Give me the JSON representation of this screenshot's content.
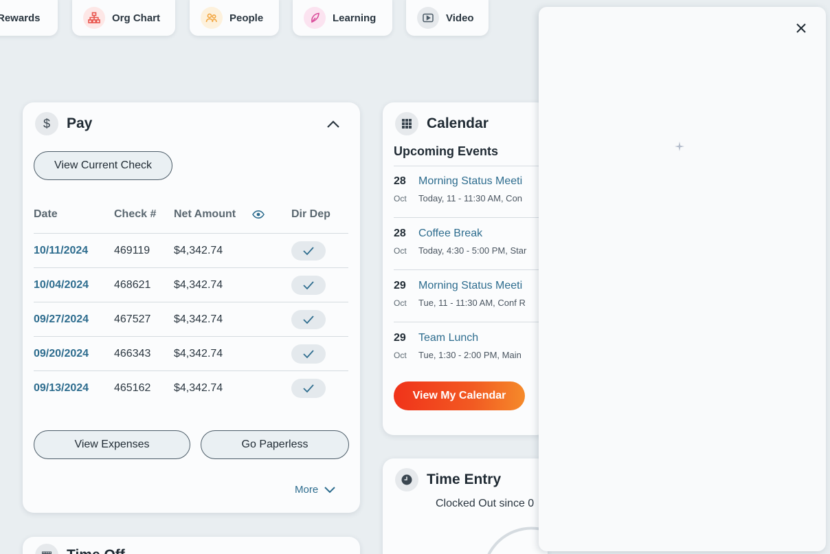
{
  "quick_links": [
    {
      "label": "Rewards",
      "icon": "rewards-icon"
    },
    {
      "label": "Org Chart",
      "icon": "org-chart-icon",
      "color": "#e8524a"
    },
    {
      "label": "People",
      "icon": "people-icon",
      "color": "#f2a640"
    },
    {
      "label": "Learning",
      "icon": "learning-icon",
      "color": "#d94c9a"
    },
    {
      "label": "Video",
      "icon": "video-icon",
      "color": "#4a5a66"
    }
  ],
  "pay": {
    "title": "Pay",
    "view_current_check": "View Current Check",
    "columns": {
      "date": "Date",
      "check": "Check #",
      "net_amount": "Net Amount",
      "dir_dep": "Dir Dep"
    },
    "rows": [
      {
        "date": "10/11/2024",
        "check": "469119",
        "amount": "$4,342.74",
        "dir_dep": true
      },
      {
        "date": "10/04/2024",
        "check": "468621",
        "amount": "$4,342.74",
        "dir_dep": true
      },
      {
        "date": "09/27/2024",
        "check": "467527",
        "amount": "$4,342.74",
        "dir_dep": true
      },
      {
        "date": "09/20/2024",
        "check": "466343",
        "amount": "$4,342.74",
        "dir_dep": true
      },
      {
        "date": "09/13/2024",
        "check": "465162",
        "amount": "$4,342.74",
        "dir_dep": true
      }
    ],
    "view_expenses": "View Expenses",
    "go_paperless": "Go Paperless",
    "more": "More"
  },
  "calendar": {
    "title": "Calendar",
    "subtitle": "Upcoming Events",
    "events": [
      {
        "day": "28",
        "month": "Oct",
        "title": "Morning Status Meeti",
        "detail": "Today, 11 - 11:30 AM, Con"
      },
      {
        "day": "28",
        "month": "Oct",
        "title": "Coffee Break",
        "detail": "Today, 4:30 - 5:00 PM, Star"
      },
      {
        "day": "29",
        "month": "Oct",
        "title": "Morning Status Meeti",
        "detail": "Tue, 11 - 11:30 AM, Conf R"
      },
      {
        "day": "29",
        "month": "Oct",
        "title": "Team Lunch",
        "detail": "Tue, 1:30 - 2:00 PM, Main"
      }
    ],
    "view_calendar": "View My Calendar"
  },
  "time_entry": {
    "title": "Time Entry",
    "status": "Clocked Out since 0"
  },
  "time_off": {
    "title": "Time Off"
  },
  "colors": {
    "accent_link": "#2d6c8e",
    "cta_start": "#f0331a",
    "cta_end": "#f58a2a",
    "background": "#e9eef1"
  }
}
